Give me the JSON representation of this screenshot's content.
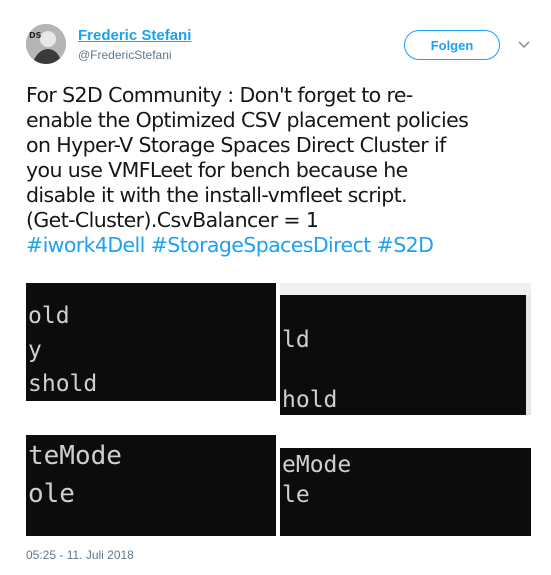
{
  "header": {
    "author_name": "Frederic Stefani",
    "author_handle": "@FredericStefani",
    "follow_label": "Folgen"
  },
  "tweet": {
    "lines": [
      "For S2D Community : Don't forget to re-",
      "enable the Optimized CSV placement policies",
      "on Hyper-V Storage Spaces Direct Cluster if",
      "you use VMFLeet for bench because he",
      "disable it with the install-vmfleet script.",
      "(Get-Cluster).CsvBalancer = 1"
    ],
    "hashtags": [
      "#iwork4Dell",
      "#StorageSpacesDirect",
      "#S2D"
    ]
  },
  "media": {
    "pane1": [
      "old",
      "y",
      "shold"
    ],
    "pane2": [
      "ld",
      "hold"
    ],
    "pane3": [
      "teMode",
      "ole"
    ],
    "pane4": [
      "eMode",
      "le"
    ]
  },
  "timestamp": "05:25 - 11. Juli 2018",
  "colors": {
    "link": "#1da1f2",
    "secondary": "#657786",
    "terminal_bg": "#0c0c0c"
  }
}
